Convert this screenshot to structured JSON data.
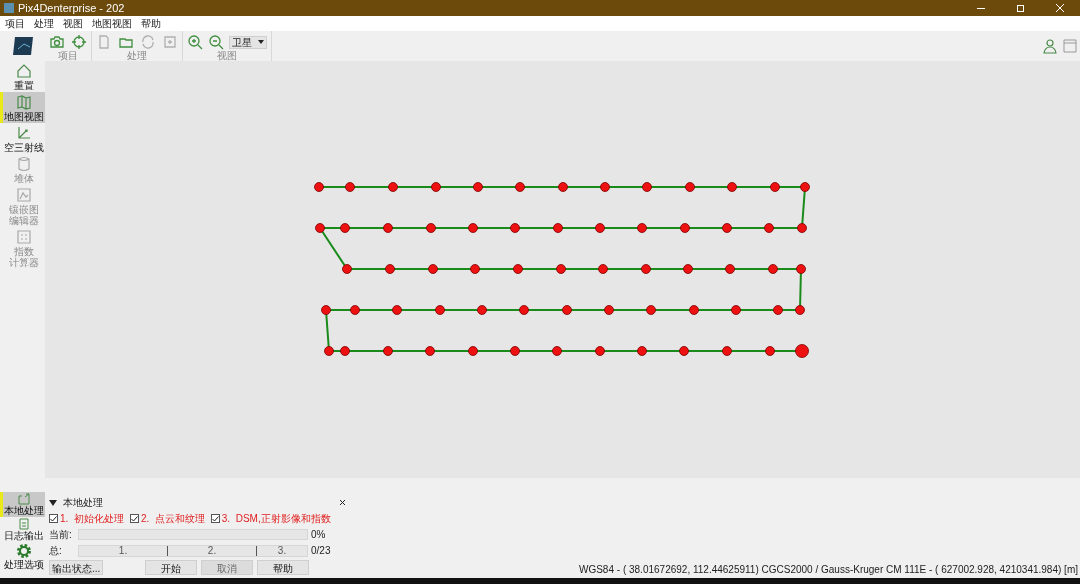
{
  "window": {
    "title": "Pix4Denterprise - 202"
  },
  "menu": [
    "项目",
    "处理",
    "视图",
    "地图视图",
    "帮助"
  ],
  "toolbar": {
    "groups": [
      {
        "label": "项目"
      },
      {
        "label": "处理"
      },
      {
        "label": "视图"
      }
    ],
    "view_select": "卫星"
  },
  "sidebar": {
    "items": [
      {
        "label": "重置",
        "selected": false,
        "disabled": false
      },
      {
        "label": "地图视图",
        "selected": true,
        "disabled": false
      },
      {
        "label": "空三射线",
        "selected": false,
        "disabled": false
      },
      {
        "label": "堆体",
        "selected": false,
        "disabled": true
      },
      {
        "label_lines": [
          "镶嵌图",
          "编辑器"
        ],
        "selected": false,
        "disabled": true
      },
      {
        "label_lines": [
          "指数",
          "计算器"
        ],
        "selected": false,
        "disabled": true
      }
    ],
    "bottom_items": [
      {
        "label": "本地处理",
        "selected": true
      },
      {
        "label": "日志输出",
        "selected": false
      },
      {
        "label": "处理选项",
        "selected": false
      }
    ]
  },
  "processing": {
    "title": "本地处理",
    "steps": [
      {
        "label": "1.  初始化处理",
        "checked": true
      },
      {
        "label": "2.  点云和纹理",
        "checked": true
      },
      {
        "label": "3.  DSM,正射影像和指数",
        "checked": true
      }
    ],
    "current_label": "当前:",
    "current": {
      "level": 0,
      "reading": "0%"
    },
    "total_label": "总:",
    "total": {
      "segments": [
        "1.",
        "2.",
        "3."
      ],
      "reading": "0/23"
    },
    "output_button": "输出状态...",
    "buttons": [
      {
        "label": "开始",
        "disabled": false
      },
      {
        "label": "取消",
        "disabled": true
      },
      {
        "label": "帮助",
        "disabled": false
      }
    ]
  },
  "status_bar": "WGS84 - ( 38.01672692,  112.44625911) CGCS2000 / Gauss-Kruger CM 111E - (   627002.928,   4210341.984) [m]"
}
